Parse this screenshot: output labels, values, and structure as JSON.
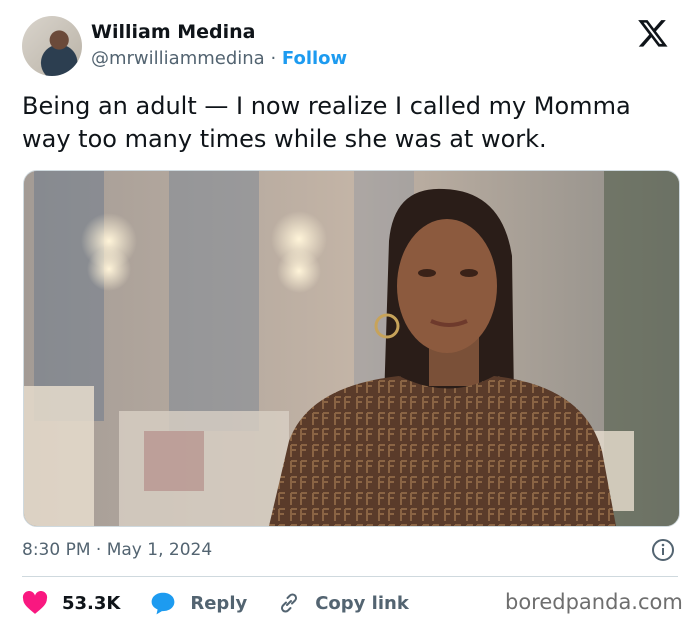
{
  "author": {
    "name": "William Medina",
    "handle": "@mrwilliammedina",
    "separator": "·",
    "follow_label": "Follow"
  },
  "tweet": {
    "text": "Being an adult — I now realize I called my Momma way too many times while she was at work.",
    "timestamp": "8:30 PM · May 1, 2024"
  },
  "actions": {
    "likes": "53.3K",
    "reply_label": "Reply",
    "copy_link_label": "Copy link"
  },
  "icons": {
    "platform_logo": "x-logo-icon",
    "info": "info-icon",
    "like": "heart-icon",
    "reply": "speech-bubble-icon",
    "copy_link": "link-icon"
  },
  "colors": {
    "accent": "#1d9bf0",
    "heart": "#f91880",
    "text": "#0f1419",
    "muted": "#536471"
  },
  "watermark": "boredpanda.com"
}
